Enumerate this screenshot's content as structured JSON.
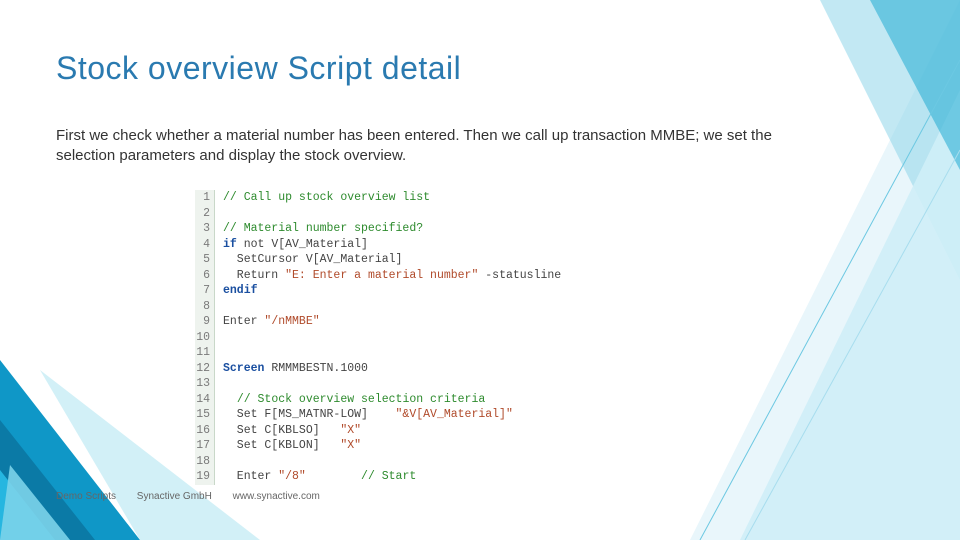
{
  "title": "Stock overview   Script detail",
  "body": "First we check whether a material number has been entered. Then we call up transaction MMBE; we set the selection parameters and display the stock overview.",
  "code": [
    {
      "n": 1,
      "tokens": [
        [
          "comment",
          "// Call up stock overview list"
        ]
      ]
    },
    {
      "n": 2,
      "tokens": [
        [
          "plain",
          ""
        ]
      ]
    },
    {
      "n": 3,
      "tokens": [
        [
          "comment",
          "// Material number specified?"
        ]
      ]
    },
    {
      "n": 4,
      "tokens": [
        [
          "kw",
          "if"
        ],
        [
          "plain",
          " not V[AV_Material]"
        ]
      ]
    },
    {
      "n": 5,
      "tokens": [
        [
          "plain",
          "  SetCursor V[AV_Material]"
        ]
      ]
    },
    {
      "n": 6,
      "tokens": [
        [
          "plain",
          "  Return "
        ],
        [
          "str",
          "\"E: Enter a material number\""
        ],
        [
          "plain",
          " -statusline"
        ]
      ]
    },
    {
      "n": 7,
      "tokens": [
        [
          "kw",
          "endif"
        ]
      ]
    },
    {
      "n": 8,
      "tokens": [
        [
          "plain",
          ""
        ]
      ]
    },
    {
      "n": 9,
      "tokens": [
        [
          "plain",
          "Enter "
        ],
        [
          "str",
          "\"/nMMBE\""
        ]
      ]
    },
    {
      "n": 10,
      "tokens": [
        [
          "plain",
          ""
        ]
      ]
    },
    {
      "n": 11,
      "tokens": [
        [
          "plain",
          ""
        ]
      ]
    },
    {
      "n": 12,
      "tokens": [
        [
          "kw",
          "Screen"
        ],
        [
          "plain",
          " RMMMBESTN.1000"
        ]
      ]
    },
    {
      "n": 13,
      "tokens": [
        [
          "plain",
          ""
        ]
      ]
    },
    {
      "n": 14,
      "tokens": [
        [
          "plain",
          "  "
        ],
        [
          "comment",
          "// Stock overview selection criteria"
        ]
      ]
    },
    {
      "n": 15,
      "tokens": [
        [
          "plain",
          "  Set F[MS_MATNR-LOW]    "
        ],
        [
          "str",
          "\"&V[AV_Material]\""
        ]
      ]
    },
    {
      "n": 16,
      "tokens": [
        [
          "plain",
          "  Set C[KBLSO]   "
        ],
        [
          "str",
          "\"X\""
        ]
      ]
    },
    {
      "n": 17,
      "tokens": [
        [
          "plain",
          "  Set C[KBLON]   "
        ],
        [
          "str",
          "\"X\""
        ]
      ]
    },
    {
      "n": 18,
      "tokens": [
        [
          "plain",
          ""
        ]
      ]
    },
    {
      "n": 19,
      "tokens": [
        [
          "plain",
          "  Enter "
        ],
        [
          "str",
          "\"/8\""
        ],
        [
          "plain",
          "        "
        ],
        [
          "comment",
          "// Start"
        ]
      ]
    }
  ],
  "footer": [
    "Demo Scripts",
    "Synactive GmbH",
    "www.synactive.com"
  ]
}
